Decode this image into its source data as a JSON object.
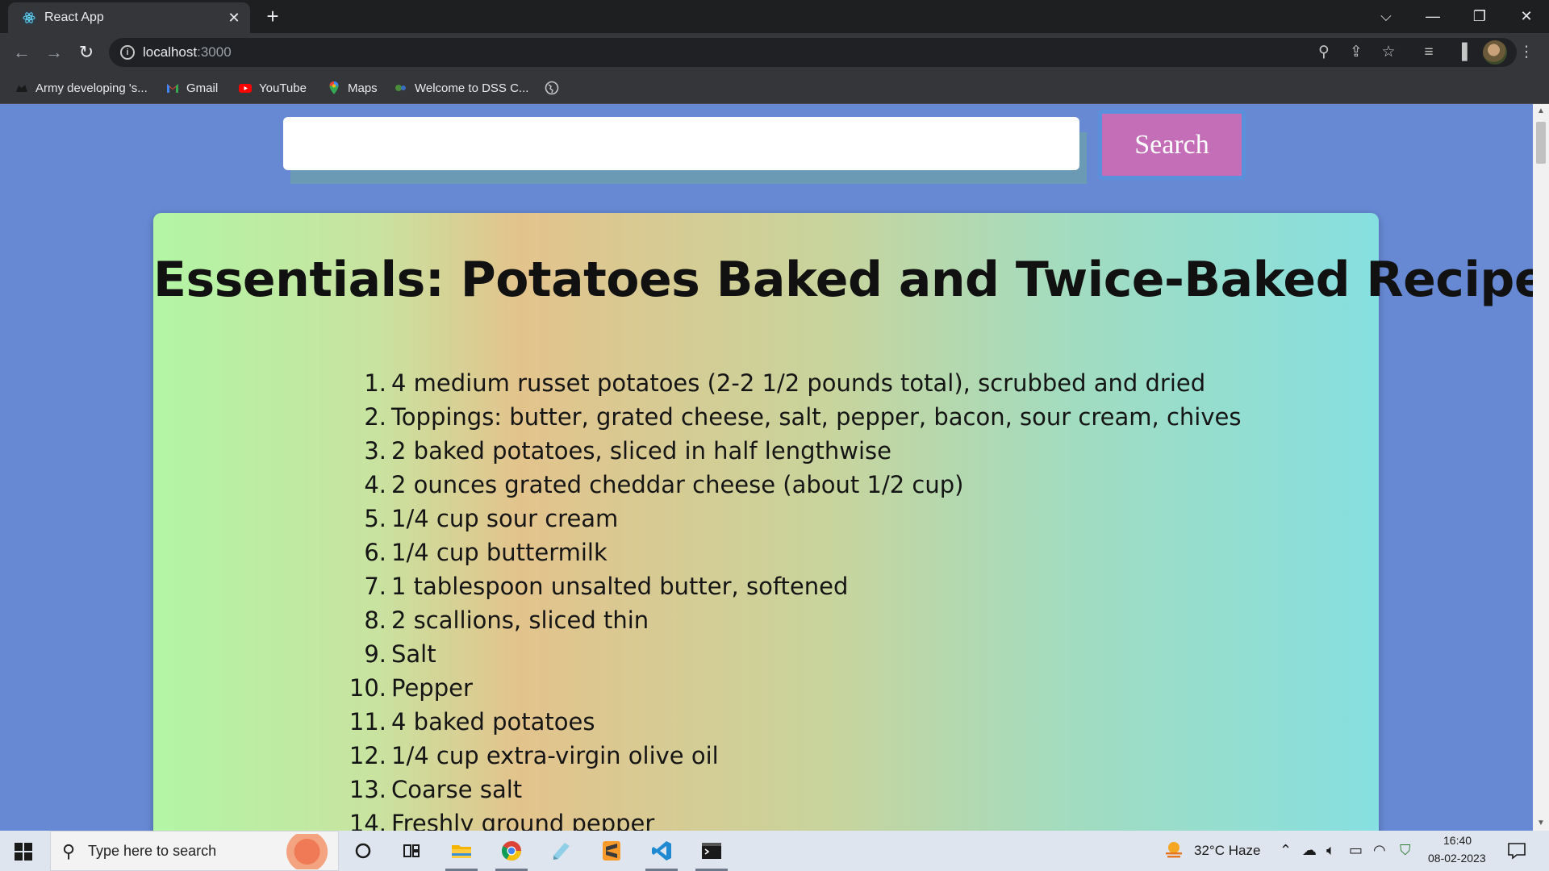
{
  "browser": {
    "tab_title": "React App",
    "tab_close": "✕",
    "new_tab": "+",
    "url_host": "localhost",
    "url_port": ":3000",
    "bookmarks": [
      {
        "label": "Army developing 's...",
        "icon": "army-icon"
      },
      {
        "label": "Gmail",
        "icon": "gmail-icon"
      },
      {
        "label": "YouTube",
        "icon": "youtube-icon"
      },
      {
        "label": "Maps",
        "icon": "maps-icon"
      },
      {
        "label": "Welcome to DSS C...",
        "icon": "dss-icon"
      }
    ]
  },
  "search": {
    "placeholder": "",
    "button_label": "Search"
  },
  "recipe": {
    "title": "Essentials: Potatoes Baked and Twice-Baked Recipe",
    "ingredients": [
      "4 medium russet potatoes (2-2 1/2 pounds total), scrubbed and dried",
      "Toppings: butter, grated cheese, salt, pepper, bacon, sour cream, chives",
      "2 baked potatoes, sliced in half lengthwise",
      "2 ounces grated cheddar cheese (about 1/2 cup)",
      "1/4 cup sour cream",
      "1/4 cup buttermilk",
      "1 tablespoon unsalted butter, softened",
      "2 scallions, sliced thin",
      "Salt",
      "Pepper",
      "4 baked potatoes",
      "1/4 cup extra-virgin olive oil",
      "Coarse salt",
      "Freshly ground pepper"
    ]
  },
  "taskbar": {
    "search_placeholder": "Type here to search",
    "weather": "32°C  Haze",
    "time": "16:40",
    "date": "08-02-2023"
  },
  "colors": {
    "page_bg": "#6789d4",
    "search_button": "#c56eb8",
    "search_button_border": "#5a8fdc"
  }
}
